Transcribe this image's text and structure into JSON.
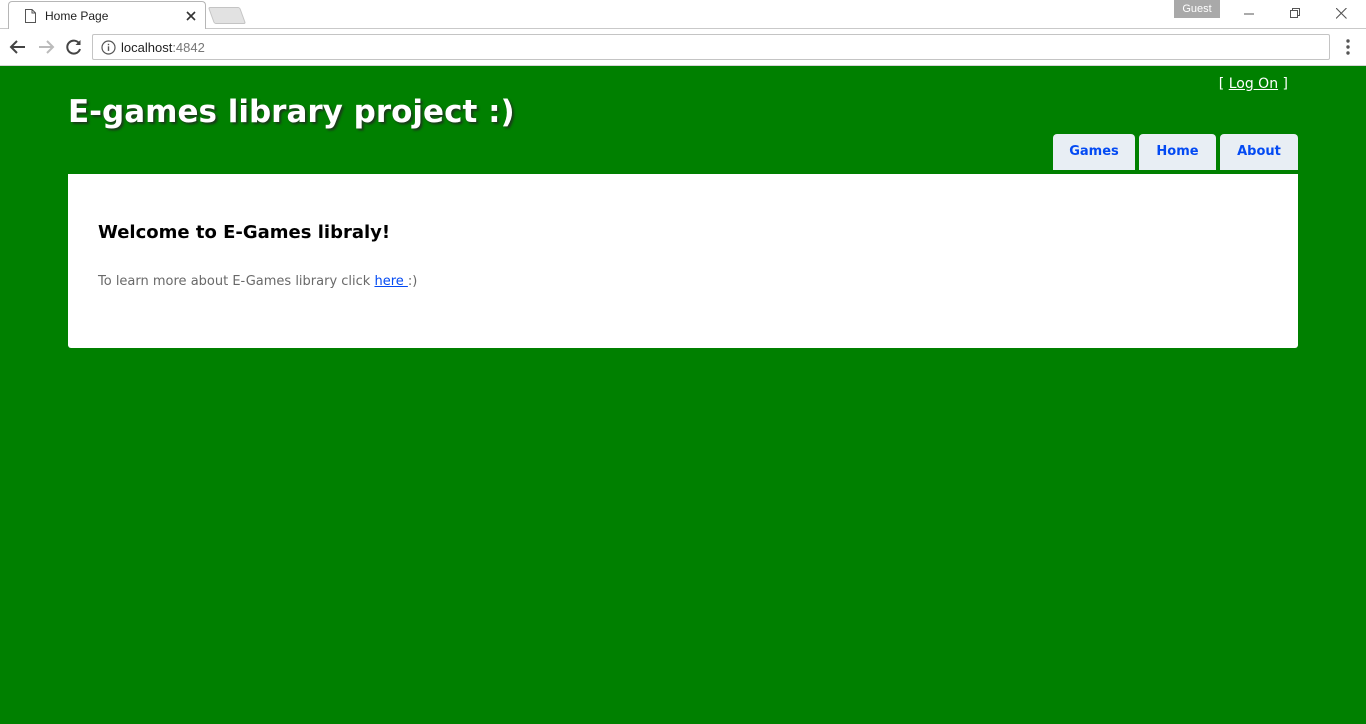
{
  "browser": {
    "tab_title": "Home Page",
    "profile_label": "Guest",
    "url_host": "localhost",
    "url_port": ":4842"
  },
  "header": {
    "login_open": "[ ",
    "login_link": "Log On",
    "login_close": " ]",
    "site_title": "E-games library project :)"
  },
  "menu": {
    "items": [
      {
        "label": "Games"
      },
      {
        "label": "Home"
      },
      {
        "label": "About"
      }
    ]
  },
  "main": {
    "heading": "Welcome to E-Games libraly!",
    "intro_text": "To learn more about E-Games library click ",
    "intro_link": "here ",
    "intro_suffix": ":)"
  },
  "colors": {
    "page_background": "#008000",
    "menu_tab_background": "#e8eef4",
    "link": "#034af3"
  }
}
